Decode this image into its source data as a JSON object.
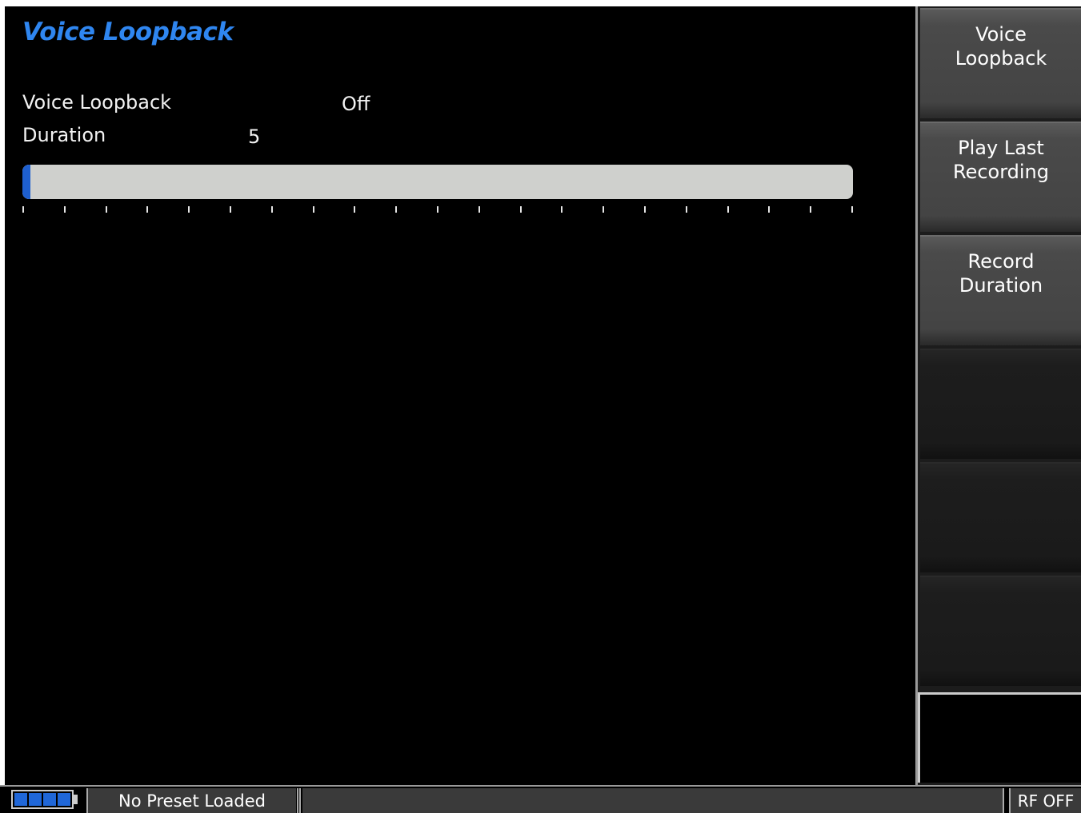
{
  "page": {
    "title": "Voice Loopback"
  },
  "settings": [
    {
      "label": "Voice Loopback",
      "value": "Off"
    },
    {
      "label": "Duration",
      "value": "5"
    }
  ],
  "progress": {
    "fraction": 0.01
  },
  "softkeys": [
    {
      "label": "Voice\nLoopback"
    },
    {
      "label": "Play Last\nRecording"
    },
    {
      "label": "Record\nDuration"
    },
    {
      "label": ""
    },
    {
      "label": ""
    },
    {
      "label": ""
    }
  ],
  "status": {
    "battery_cells": 4,
    "preset": "No Preset Loaded",
    "message": "",
    "rf": "RF OFF"
  },
  "colors": {
    "title": "#2f86f0",
    "progress_fill": "#1e5fcf",
    "progress_track": "#cfd0cd",
    "background": "#000000"
  }
}
